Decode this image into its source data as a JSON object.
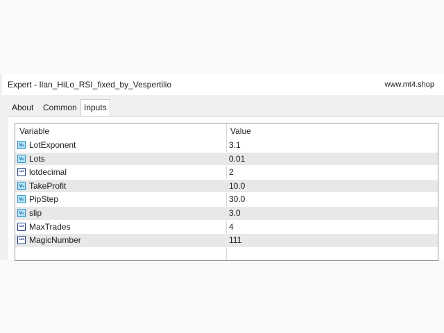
{
  "window": {
    "title": "Expert - Ilan_HiLo_RSI_fixed_by_Vespertilio",
    "watermark": "www.mt4.shop"
  },
  "tabs": [
    {
      "label": "About",
      "active": false
    },
    {
      "label": "Common",
      "active": false
    },
    {
      "label": "Inputs",
      "active": true
    }
  ],
  "table": {
    "headers": {
      "variable": "Variable",
      "value": "Value"
    },
    "rows": [
      {
        "icon": "double-variable-icon",
        "name": "LotExponent",
        "value": "3.1"
      },
      {
        "icon": "double-variable-icon",
        "name": "Lots",
        "value": "0.01"
      },
      {
        "icon": "integer-variable-icon",
        "name": "lotdecimal",
        "value": "2"
      },
      {
        "icon": "double-variable-icon",
        "name": "TakeProfit",
        "value": "10.0"
      },
      {
        "icon": "double-variable-icon",
        "name": "PipStep",
        "value": "30.0"
      },
      {
        "icon": "double-variable-icon",
        "name": "slip",
        "value": "3.0"
      },
      {
        "icon": "integer-variable-icon",
        "name": "MaxTrades",
        "value": "4"
      },
      {
        "icon": "integer-variable-icon",
        "name": "MagicNumber",
        "value": "111"
      }
    ]
  },
  "colors": {
    "alt_row": "#e8e8e8",
    "window_bg": "#f0f0f0",
    "grid_border": "#9a9a9a"
  }
}
